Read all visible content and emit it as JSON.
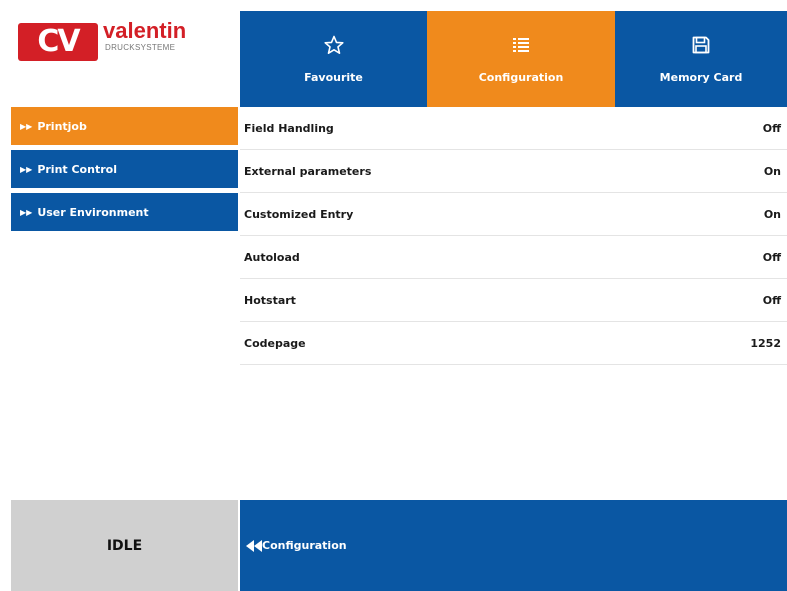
{
  "brand": {
    "logo_mark": "CV",
    "name": "valentin",
    "subtitle": "DRUCKSYSTEME",
    "color": "#d31f26"
  },
  "colors": {
    "primary": "#0a57a3",
    "active": "#f08a1c",
    "status_bg": "#d0d0d0"
  },
  "tabs": [
    {
      "label": "Favourite",
      "icon": "star-icon",
      "active": false
    },
    {
      "label": "Configuration",
      "icon": "list-icon",
      "active": true
    },
    {
      "label": "Memory Card",
      "icon": "memory-card-icon",
      "active": false
    }
  ],
  "sidebar": {
    "items": [
      {
        "label": "Printjob",
        "active": true
      },
      {
        "label": "Print Control",
        "active": false
      },
      {
        "label": "User Environment",
        "active": false
      }
    ]
  },
  "settings": {
    "rows": [
      {
        "name": "Field Handling",
        "value": "Off"
      },
      {
        "name": "External parameters",
        "value": "On"
      },
      {
        "name": "Customized Entry",
        "value": "On"
      },
      {
        "name": "Autoload",
        "value": "Off"
      },
      {
        "name": "Hotstart",
        "value": "Off"
      },
      {
        "name": "Codepage",
        "value": "1252"
      }
    ]
  },
  "footer": {
    "status": "IDLE",
    "back_label": "Configuration",
    "back_icon": "double-chevron-left-icon"
  }
}
